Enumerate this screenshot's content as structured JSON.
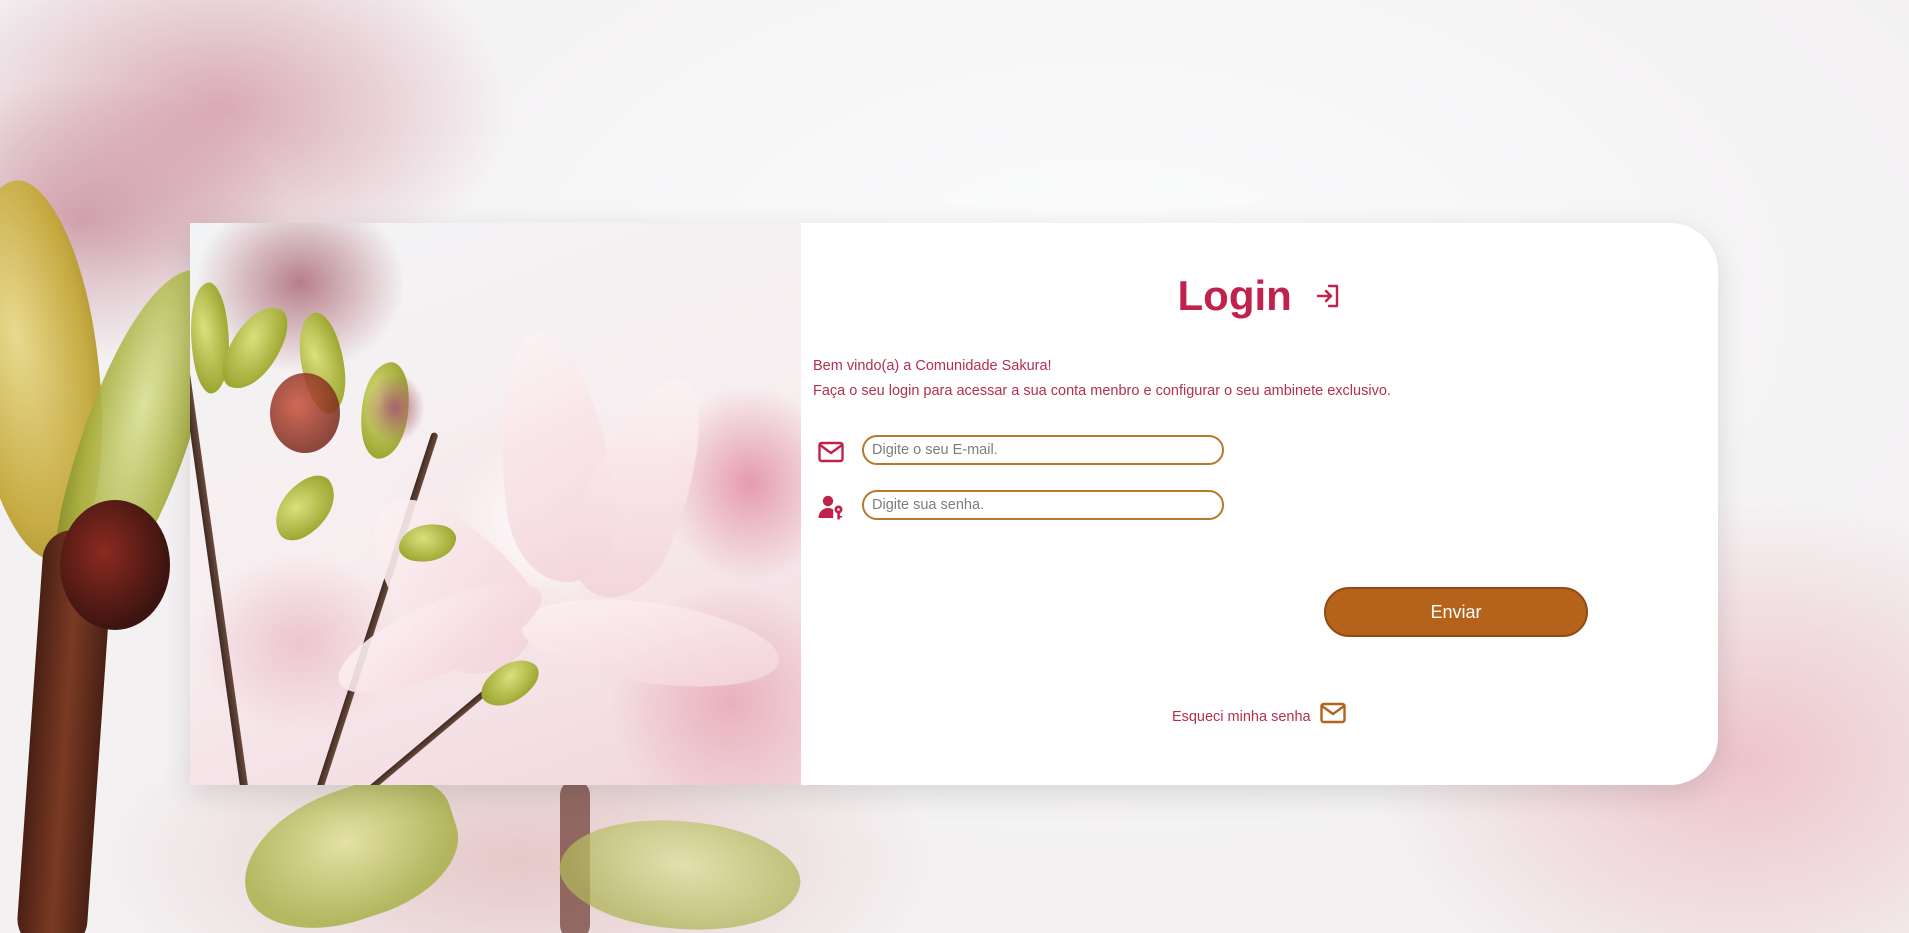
{
  "login": {
    "title": "Login",
    "welcome_line_1": "Bem vindo(a) a Comunidade Sakura!",
    "welcome_line_2": "Faça o seu login para acessar a sua conta menbro e configurar o seu ambinete exclusivo.",
    "email_placeholder": "Digite o seu E-mail.",
    "password_placeholder": "Digite sua senha.",
    "submit_label": "Enviar",
    "forgot_label": "Esqueci minha senha"
  },
  "icons": {
    "title": "login-icon",
    "email": "envelope-icon",
    "password": "user-key-icon",
    "forgot": "envelope-icon"
  },
  "colors": {
    "accent": "#c1224b",
    "text": "#b3304f",
    "button": "#b5621b",
    "input_border": "#b6782c"
  }
}
